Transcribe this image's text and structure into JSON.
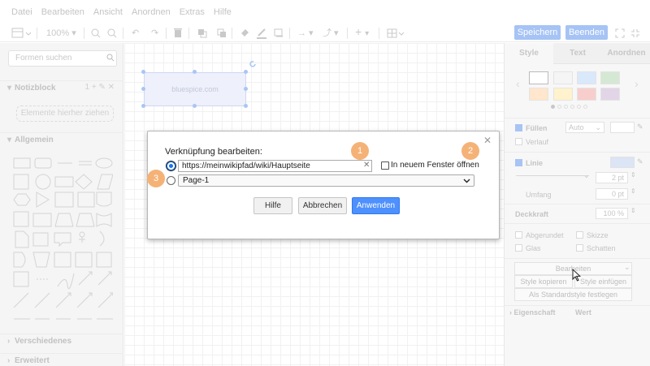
{
  "menu": [
    "Datei",
    "Bearbeiten",
    "Ansicht",
    "Anordnen",
    "Extras",
    "Hilfe"
  ],
  "toolbar": {
    "zoom": "100%",
    "save_label": "Speichern",
    "exit_label": "Beenden"
  },
  "sidebar": {
    "search_placeholder": "Formen suchen",
    "sections": {
      "notizblock": "Notizblock",
      "allgemein": "Allgemein",
      "verschiedenes": "Verschiedenes",
      "erweitert": "Erweitert"
    },
    "drop_zone": "Elemente hierher ziehen"
  },
  "canvas": {
    "shape_label": "bluespice.com"
  },
  "panel": {
    "tabs": [
      "Style",
      "Text",
      "Anordnen"
    ],
    "fill_label": "Füllen",
    "fill_value": "Auto",
    "gradient_label": "Verlauf",
    "line_label": "Linie",
    "line_width": "2 pt",
    "perimeter_label": "Umfang",
    "perimeter_value": "0 pt",
    "opacity_label": "Deckkraft",
    "opacity_value": "100 %",
    "rounded": "Abgerundet",
    "sketch": "Skizze",
    "glass": "Glas",
    "shadow": "Schatten",
    "edit_button": "Bearbeiten",
    "copy_style": "Style kopieren",
    "paste_style": "Style einfügen",
    "default_style": "Als Standardstyle festlegen",
    "property_header": "Eigenschaft",
    "value_header": "Wert",
    "swatch_colors": [
      "#ffffff",
      "#f5f5f5",
      "#dae8fc",
      "#d5e8d4",
      "#ffe6cc",
      "#fff2cc",
      "#f8cecc",
      "#e1d5e7"
    ]
  },
  "dialog": {
    "title": "Verknüpfung bearbeiten:",
    "url": "https://meinwikipfad/wiki/Hauptseite",
    "new_window": "In neuem Fenster öffnen",
    "page": "Page-1",
    "help": "Hilfe",
    "cancel": "Abbrechen",
    "apply": "Anwenden"
  },
  "callouts": [
    "1",
    "2",
    "3"
  ],
  "colors": {
    "primary_button": "#4d90fe",
    "callout": "#f5b277",
    "disabled_button": "#a6c3f5"
  }
}
